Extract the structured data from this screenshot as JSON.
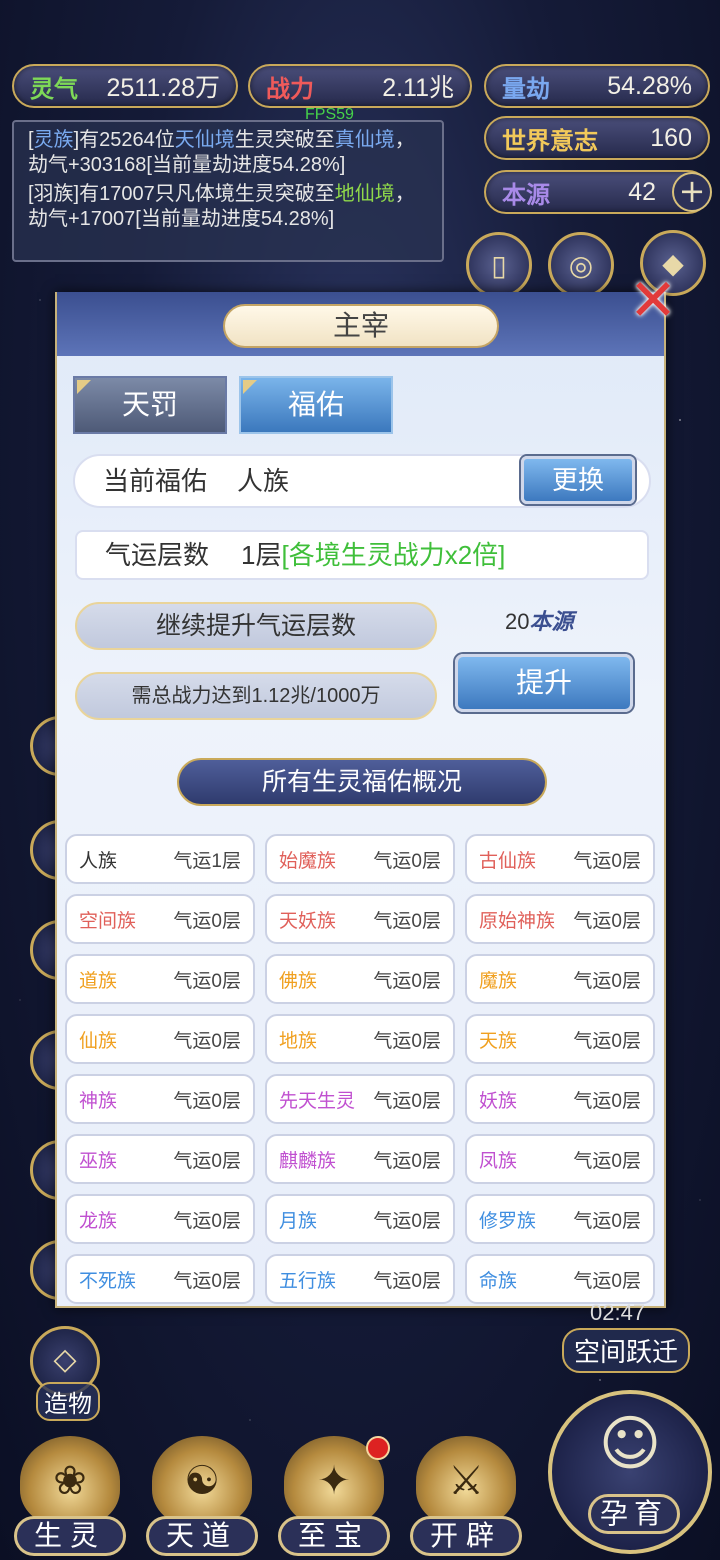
{
  "hud": {
    "fps": "FPS59",
    "stats": [
      {
        "label": "灵气",
        "value": "2511.28万",
        "color": "#7ed957"
      },
      {
        "label": "战力",
        "value": "2.11兆",
        "color": "#f05a5a"
      },
      {
        "label": "量劫",
        "value": "54.28%",
        "color": "#7aa8f0"
      },
      {
        "label": "世界意志",
        "value": "160",
        "color": "#f2c95a"
      },
      {
        "label": "本源",
        "value": "42",
        "color": "#a88ae8"
      }
    ],
    "plus_icon": "plus-icon"
  },
  "log": {
    "line1": {
      "race": "灵族",
      "t1": "有25264位",
      "realm_from": "天仙境",
      "t2": "生灵突破至",
      "realm_to": "真仙境",
      "t3": "，劫气+303168[当前量劫进度54.28%]"
    },
    "line2": {
      "race": "[羽族]",
      "t1": "有17007只凡体境生灵突破至",
      "realm_to": "地仙境",
      "t3": "，劫气+17007[当前量劫进度54.28%]"
    }
  },
  "modal": {
    "title": "主宰",
    "close_icon": "close-x-icon",
    "tabs": [
      {
        "label": "天罚",
        "active": false
      },
      {
        "label": "福佑",
        "active": true
      }
    ],
    "current": {
      "label": "当前福佑",
      "value": "人族",
      "change_button": "更换"
    },
    "luck": {
      "label": "气运层数",
      "value": "1层",
      "bonus": "[各境生灵战力x2倍]"
    },
    "continue_label": "继续提升气运层数",
    "requirement": "需总战力达到1.12兆/1000万",
    "cost": {
      "amount": "20",
      "unit": "本源"
    },
    "raise_button": "提升",
    "section_title": "所有生灵福佑概况",
    "races": [
      {
        "name": "人族",
        "level": "气运1层",
        "color": "#333333"
      },
      {
        "name": "始魔族",
        "level": "气运0层",
        "color": "#e0605a"
      },
      {
        "name": "古仙族",
        "level": "气运0层",
        "color": "#e0605a"
      },
      {
        "name": "空间族",
        "level": "气运0层",
        "color": "#e0605a"
      },
      {
        "name": "天妖族",
        "level": "气运0层",
        "color": "#e0605a"
      },
      {
        "name": "原始神族",
        "level": "气运0层",
        "color": "#e0605a"
      },
      {
        "name": "道族",
        "level": "气运0层",
        "color": "#f0a020"
      },
      {
        "name": "佛族",
        "level": "气运0层",
        "color": "#f0a020"
      },
      {
        "name": "魔族",
        "level": "气运0层",
        "color": "#f0a020"
      },
      {
        "name": "仙族",
        "level": "气运0层",
        "color": "#f0a020"
      },
      {
        "name": "地族",
        "level": "气运0层",
        "color": "#f0a020"
      },
      {
        "name": "天族",
        "level": "气运0层",
        "color": "#f0a020"
      },
      {
        "name": "神族",
        "level": "气运0层",
        "color": "#c050d0"
      },
      {
        "name": "先天生灵",
        "level": "气运0层",
        "color": "#c050d0"
      },
      {
        "name": "妖族",
        "level": "气运0层",
        "color": "#c050d0"
      },
      {
        "name": "巫族",
        "level": "气运0层",
        "color": "#c050d0"
      },
      {
        "name": "麒麟族",
        "level": "气运0层",
        "color": "#c050d0"
      },
      {
        "name": "凤族",
        "level": "气运0层",
        "color": "#c050d0"
      },
      {
        "name": "龙族",
        "level": "气运0层",
        "color": "#c050d0"
      },
      {
        "name": "月族",
        "level": "气运0层",
        "color": "#3f8ee0"
      },
      {
        "name": "修罗族",
        "level": "气运0层",
        "color": "#3f8ee0"
      },
      {
        "name": "不死族",
        "level": "气运0层",
        "color": "#3f8ee0"
      },
      {
        "name": "五行族",
        "level": "气运0层",
        "color": "#3f8ee0"
      },
      {
        "name": "命族",
        "level": "气运0层",
        "color": "#3f8ee0"
      }
    ]
  },
  "side": {
    "timer": "02:47",
    "space_jump": "空间跃迁",
    "creation": "造物"
  },
  "nav": {
    "items": [
      {
        "label": "生灵",
        "icon": "phoenix-emblem-icon"
      },
      {
        "label": "天道",
        "icon": "swirl-emblem-icon"
      },
      {
        "label": "至宝",
        "icon": "treasure-emblem-icon"
      },
      {
        "label": "开辟",
        "icon": "axe-emblem-icon"
      }
    ],
    "nurture": {
      "label": "孕育",
      "icon": "embryo-icon"
    }
  }
}
